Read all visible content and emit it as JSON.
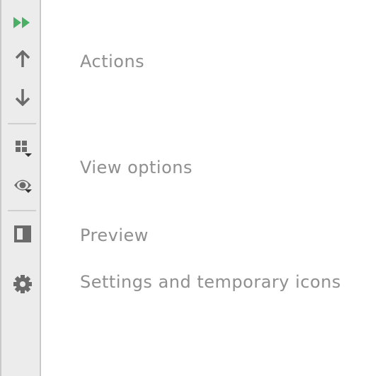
{
  "toolbar": {
    "items": [
      {
        "icon": "fast-forward-icon",
        "color": "#4caf66"
      },
      {
        "icon": "arrow-up-icon"
      },
      {
        "icon": "arrow-down-icon"
      },
      {
        "icon": "grid-dropdown-icon"
      },
      {
        "icon": "eye-dropdown-icon"
      },
      {
        "icon": "preview-panel-icon"
      },
      {
        "icon": "gear-icon"
      }
    ]
  },
  "labels": {
    "actions": "Actions",
    "view_options": "View options",
    "preview": "Preview",
    "settings": "Settings and temporary icons"
  }
}
